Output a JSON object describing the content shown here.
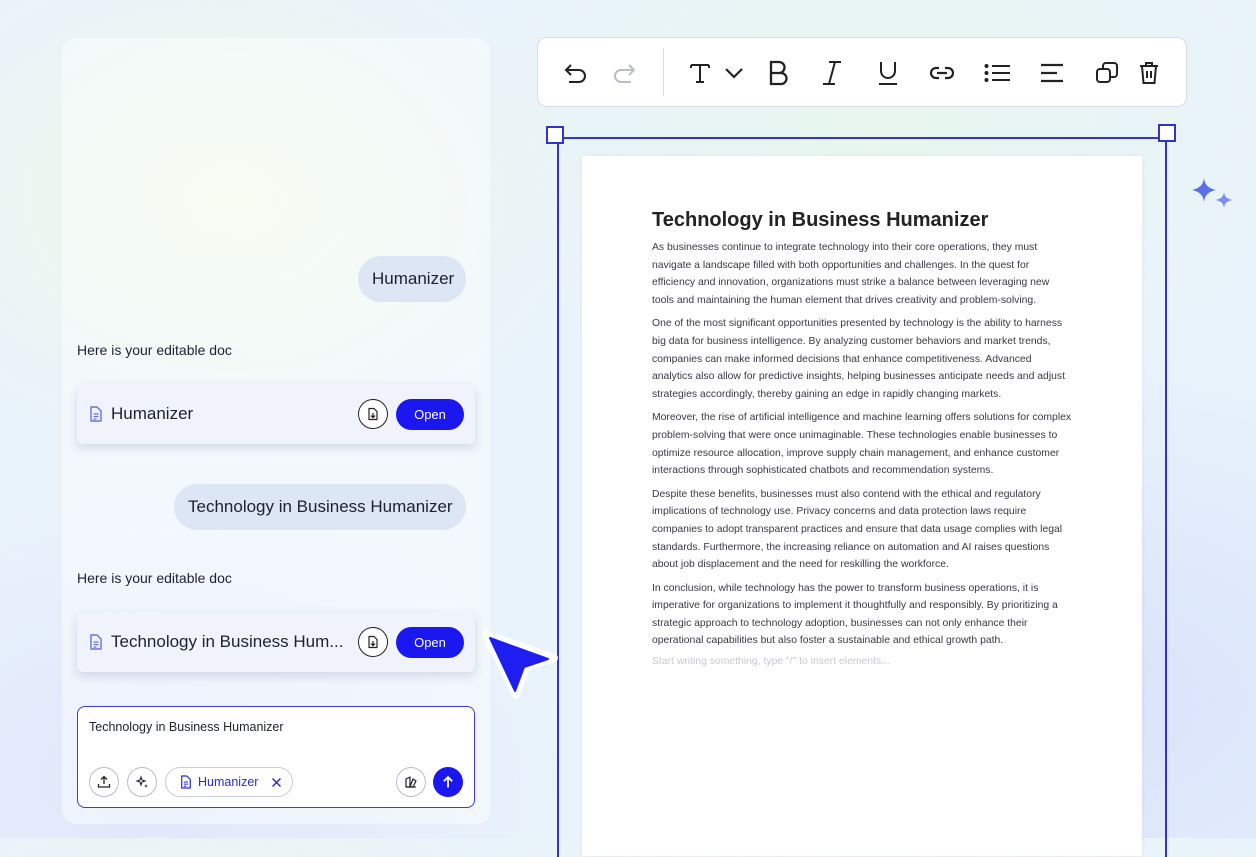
{
  "chat": {
    "messages": [
      {
        "role": "user",
        "text": "Humanizer"
      },
      {
        "role": "assistant",
        "text": "Here is your editable doc",
        "doc_title": "Humanizer",
        "open_label": "Open"
      },
      {
        "role": "user",
        "text": "Technology in Business Humanizer"
      },
      {
        "role": "assistant",
        "text": "Here is your editable doc",
        "doc_title": "Technology in Business Hum...",
        "open_label": "Open"
      }
    ],
    "input": {
      "value": "Technology in Business Humanizer",
      "chip_label": "Humanizer"
    }
  },
  "toolbar": {
    "icons": [
      "undo-icon",
      "redo-icon",
      "text-style-icon",
      "chevron-down-icon",
      "bold-icon",
      "italic-icon",
      "underline-icon",
      "link-icon",
      "bullet-list-icon",
      "align-icon",
      "duplicate-icon",
      "delete-icon"
    ]
  },
  "document": {
    "title": "Technology in Business Humanizer",
    "paragraphs": [
      "As businesses continue to integrate technology into their core operations, they must navigate a landscape filled with both opportunities and challenges. In the quest for efficiency and innovation, organizations must strike a balance between leveraging new tools and maintaining the human element that drives creativity and problem-solving.",
      "One of the most significant opportunities presented by technology is the ability to harness big data for business intelligence. By analyzing customer behaviors and market trends, companies can make informed decisions that enhance competitiveness. Advanced analytics also allow for predictive insights, helping businesses anticipate needs and adjust strategies accordingly, thereby gaining an edge in rapidly changing markets.",
      "Moreover, the rise of artificial intelligence and machine learning offers solutions for complex problem-solving that were once unimaginable. These technologies enable businesses to optimize resource allocation, improve supply chain management, and enhance customer interactions through sophisticated chatbots and recommendation systems.",
      "Despite these benefits, businesses must also contend with the ethical and regulatory implications of technology use. Privacy concerns and data protection laws require companies to adopt transparent practices and ensure that data usage complies with legal standards. Furthermore, the increasing reliance on automation and AI raises questions about job displacement and the need for reskilling the workforce.",
      "In conclusion, while technology has the power to transform business operations, it is imperative for organizations to implement it thoughtfully and responsibly. By prioritizing a strategic approach to technology adoption, businesses can not only enhance their operational capabilities but also foster a sustainable and ethical growth path."
    ],
    "placeholder": "Start writing something, type \"/\" to insert elements..."
  },
  "colors": {
    "accent": "#1a17f0",
    "frame": "#3433c9",
    "bubble": "#dde6f5"
  }
}
